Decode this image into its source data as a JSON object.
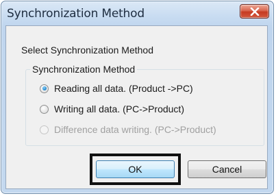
{
  "window": {
    "title": "Synchronization Method"
  },
  "dialog": {
    "prompt": "Select Synchronization Method",
    "group_label": "Synchronization Method",
    "options": [
      {
        "label": "Reading all data. (Product ->PC)",
        "selected": true,
        "enabled": true
      },
      {
        "label": "Writing all data. (PC->Product)",
        "selected": false,
        "enabled": true
      },
      {
        "label": "Difference data writing. (PC->Product)",
        "selected": false,
        "enabled": false
      }
    ]
  },
  "buttons": {
    "ok_label": "OK",
    "cancel_label": "Cancel"
  },
  "icons": {
    "close": "close-icon",
    "radio": "radio-button"
  },
  "colors": {
    "close_button": "#c63b22",
    "title_bar": "#c8dcf1",
    "selected_radio": "#2b8fd3",
    "highlight_frame": "#111111"
  }
}
